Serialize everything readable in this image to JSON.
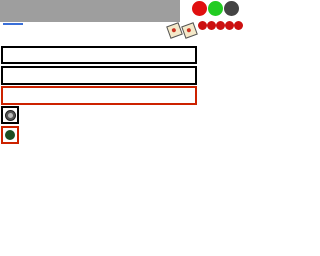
{
  "title_bar": {
    "title": ""
  },
  "window_controls": {
    "close_color": "#e01010",
    "maximize_color": "#22cc22",
    "minimize_color": "#444444"
  },
  "toolbar": {
    "note_icons": [
      "note-icon",
      "note-icon"
    ],
    "badges": [
      "",
      "",
      "",
      "",
      ""
    ]
  },
  "form": {
    "field_1_value": "",
    "field_2_value": "",
    "field_3_value": ""
  },
  "buttons": {
    "icon_1": "gear-icon",
    "icon_2": "circle-icon"
  },
  "colors": {
    "accent_red": "#cc2200",
    "title_bar_gray": "#9e9e9e",
    "link_blue": "#3a6fd8"
  }
}
